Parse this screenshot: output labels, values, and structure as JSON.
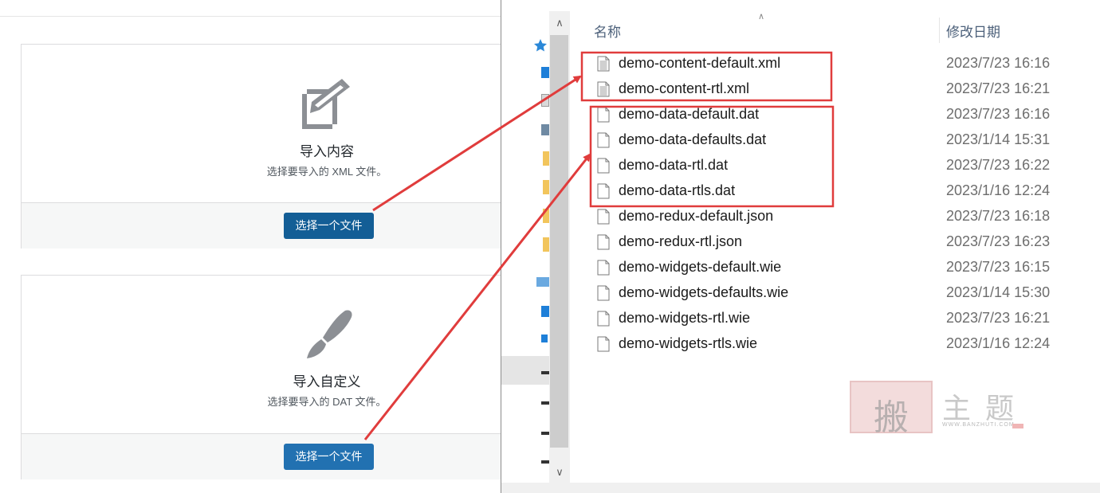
{
  "importer": {
    "cards": [
      {
        "title": "导入内容",
        "description": "选择要导入的 XML 文件。",
        "button_label": "选择一个文件",
        "icon": "edit-document-icon"
      },
      {
        "title": "导入自定义",
        "description": "选择要导入的 DAT 文件。",
        "button_label": "选择一个文件",
        "icon": "paintbrush-icon"
      }
    ]
  },
  "explorer": {
    "columns": {
      "name": "名称",
      "date": "修改日期"
    },
    "files": [
      {
        "name": "demo-content-default.xml",
        "date": "2023/7/23 16:16",
        "type": "text-file-icon"
      },
      {
        "name": "demo-content-rtl.xml",
        "date": "2023/7/23 16:21",
        "type": "text-file-icon"
      },
      {
        "name": "demo-data-default.dat",
        "date": "2023/7/23 16:16",
        "type": "blank-file-icon"
      },
      {
        "name": "demo-data-defaults.dat",
        "date": "2023/1/14 15:31",
        "type": "blank-file-icon"
      },
      {
        "name": "demo-data-rtl.dat",
        "date": "2023/7/23 16:22",
        "type": "blank-file-icon"
      },
      {
        "name": "demo-data-rtls.dat",
        "date": "2023/1/16 12:24",
        "type": "blank-file-icon"
      },
      {
        "name": "demo-redux-default.json",
        "date": "2023/7/23 16:18",
        "type": "blank-file-icon"
      },
      {
        "name": "demo-redux-rtl.json",
        "date": "2023/7/23 16:23",
        "type": "blank-file-icon"
      },
      {
        "name": "demo-widgets-default.wie",
        "date": "2023/7/23 16:15",
        "type": "blank-file-icon"
      },
      {
        "name": "demo-widgets-defaults.wie",
        "date": "2023/1/14 15:30",
        "type": "blank-file-icon"
      },
      {
        "name": "demo-widgets-rtl.wie",
        "date": "2023/7/23 16:21",
        "type": "blank-file-icon"
      },
      {
        "name": "demo-widgets-rtls.wie",
        "date": "2023/1/16 12:24",
        "type": "blank-file-icon"
      }
    ]
  },
  "annotation": {
    "highlight_color": "#e03c3c",
    "highlighted_groups": [
      "xml-files",
      "dat-files"
    ]
  },
  "watermark": {
    "stamp_char": "搬",
    "text": "主题",
    "url": "WWW.BANZHUTI.COM"
  },
  "colors": {
    "button_primary": "#135e96",
    "button_secondary": "#2271b1",
    "icon_gray": "#8c8f94"
  }
}
